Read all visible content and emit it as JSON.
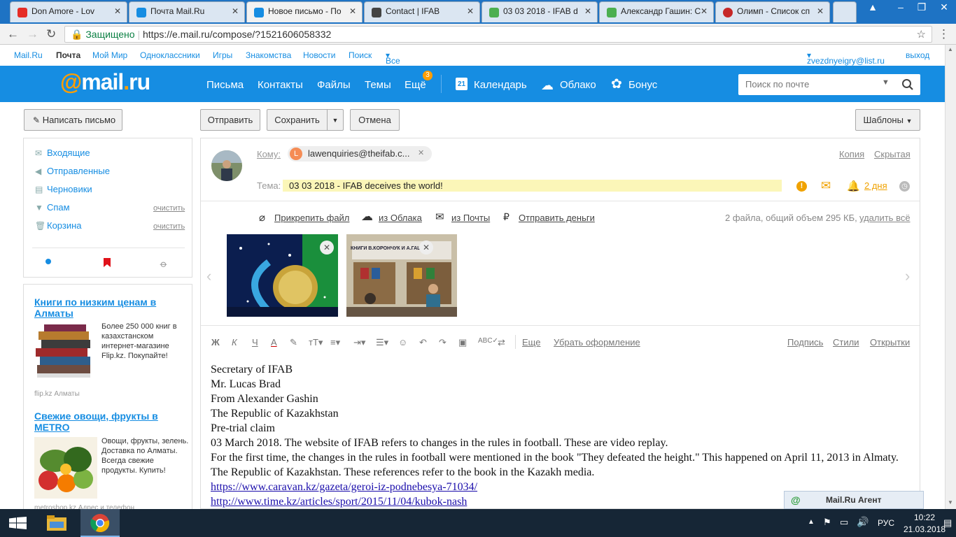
{
  "browser": {
    "tabs": [
      {
        "label": "Don Amore - Lov",
        "color": "#e52d27"
      },
      {
        "label": "Почта Mail.Ru",
        "color": "#168de2"
      },
      {
        "label": "Новое письмо - По",
        "color": "#168de2"
      },
      {
        "label": "Contact | IFAB",
        "color": "#444444"
      },
      {
        "label": "03 03 2018 - IFAB d",
        "color": "#4caf50"
      },
      {
        "label": "Александр Гашин: С",
        "color": "#4caf50"
      },
      {
        "label": "Олимп - Список сп",
        "color": "#c62828"
      }
    ],
    "secure_label": "Защищено",
    "url": "https://e.mail.ru/compose/?1521606058332"
  },
  "toplinks": {
    "mailru": "Mail.Ru",
    "pochta": "Почта",
    "moimir": "Мой Мир",
    "odnoklassniki": "Одноклассники",
    "igry": "Игры",
    "znakomstva": "Знакомства",
    "novosti": "Новости",
    "poisk": "Поиск",
    "projects": "Все проекты",
    "user": "zvezdnyeigry@list.ru",
    "logout": "выход"
  },
  "header": {
    "logo": "@mail.ru",
    "nav": {
      "letters": "Письма",
      "contacts": "Контакты",
      "files": "Файлы",
      "themes": "Темы",
      "more": "Ещё",
      "more_badge": "3",
      "calendar": "Календарь",
      "calendar_day": "21",
      "cloud": "Облако",
      "bonus": "Бонус"
    },
    "search_placeholder": "Поиск по почте"
  },
  "toolbar": {
    "write": "Написать письмо",
    "send": "Отправить",
    "save": "Сохранить",
    "cancel": "Отмена",
    "templates": "Шаблоны"
  },
  "folders": {
    "inbox": "Входящие",
    "sent": "Отправленные",
    "drafts": "Черновики",
    "spam": "Спам",
    "trash": "Корзина",
    "clear": "очистить"
  },
  "ads": [
    {
      "title": "Книги по низким ценам в Алматы",
      "text": "Более 250 000 книг в казахстанском интернет-магазине Flip.kz. Покупайте!",
      "source": "flip.kz   Алматы"
    },
    {
      "title": "Свежие овощи, фрукты в METRO",
      "text": "Овощи, фрукты, зелень. Доставка по Алматы. Всегда свежие продукты. Купить!",
      "source": "metroshop.kz   Адрес и телефон"
    }
  ],
  "compose": {
    "to_label": "Кому:",
    "recipient_initial": "L",
    "recipient": "lawenquiries@theifab.c...",
    "cc": "Копия",
    "bcc": "Скрытая",
    "subject_label": "Тема:",
    "subject": "03 03 2018 - IFAB deceives the world!",
    "reminder": "2 дня",
    "attach_file": "Прикрепить файл",
    "from_cloud": "из Облака",
    "from_mail": "из Почты",
    "send_money": "Отправить деньги",
    "files_info": "2 файла, общий объем 295 КБ,",
    "delete_all": "удалить всё",
    "more": "Еще",
    "clear_format": "Убрать оформление",
    "signature": "Подпись",
    "styles": "Стили",
    "postcards": "Открытки",
    "body_lines": [
      "Secretary of IFAB",
      "Mr. Lucas Brad",
      "From Alexander Gashin",
      "The Republic of Kazakhstan",
      "Pre-trial claim",
      "03 March 2018. The website of IFAB refers to changes in the rules in football. These are video replay.",
      "For the first time, the changes in the rules in football were mentioned in the book \"They defeated the height.\" This happened on April 11, 2013 in Almaty. The Republic of Kazakhstan. These references refer to the book in the Kazakh media."
    ],
    "links": [
      "https://www.caravan.kz/gazeta/geroi-iz-podnebesya-71034/",
      "http://www.time.kz/articles/sport/2015/11/04/kubok-nash"
    ],
    "attachment2_caption": "КНИГИ В.КОРОНЧУК И А.ГАШИН"
  },
  "agent": {
    "label": "Mail.Ru Агент"
  },
  "taskbar": {
    "lang": "РУС",
    "time": "10:22",
    "date": "21.03.2018"
  },
  "colors": {
    "brand": "#168de2",
    "orange": "#f08f00"
  }
}
